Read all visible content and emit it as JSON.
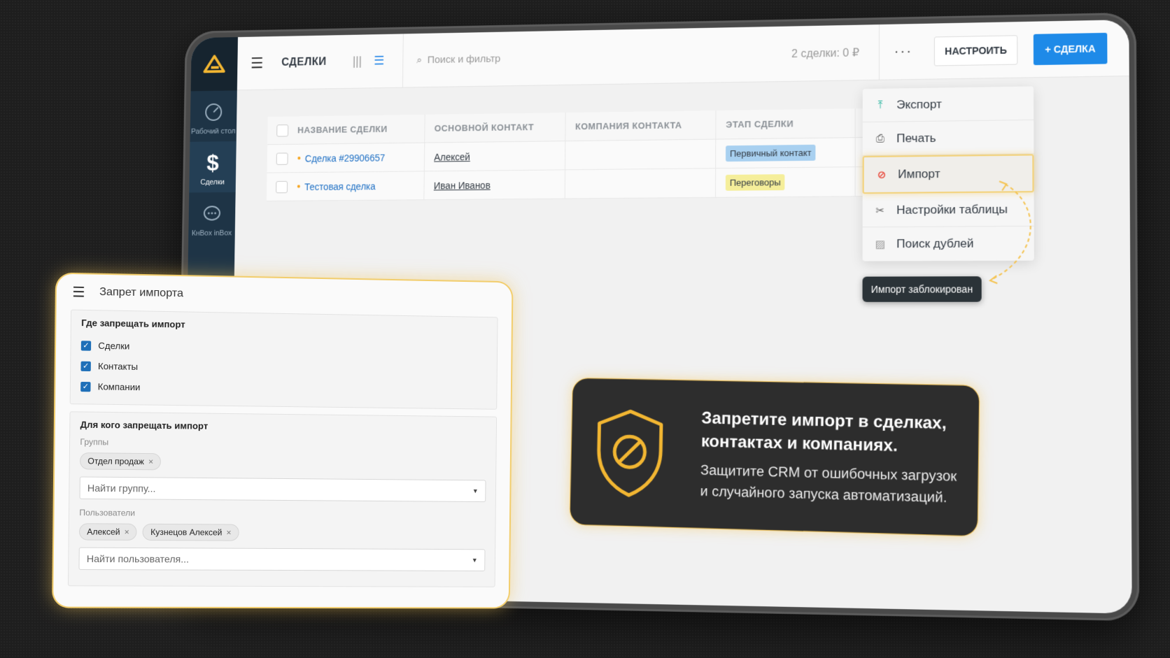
{
  "app": {
    "sidebar": {
      "items": [
        {
          "label": "Рабочий стол",
          "icon": "dashboard-icon"
        },
        {
          "label": "Сделки",
          "icon": "dollar-icon",
          "active": true
        },
        {
          "label": "КнBox inBox",
          "icon": "chat-icon"
        }
      ]
    },
    "topbar": {
      "title": "СДЕЛКИ",
      "search_placeholder": "Поиск и фильтр",
      "deal_count": "2 сделки: 0 ₽",
      "more": "···",
      "setup_button": "НАСТРОИТЬ",
      "add_button": "+ СДЕЛКА"
    },
    "table": {
      "columns": [
        "НАЗВАНИЕ СДЕЛКИ",
        "ОСНОВНОЙ КОНТАКТ",
        "КОМПАНИЯ КОНТАКТА",
        "ЭТАП СДЕЛКИ",
        ""
      ],
      "rows": [
        {
          "name": "Сделка #29906657",
          "contact": "Алексей",
          "company": "",
          "stage": "Первичный контакт",
          "stage_color": "#a8d0f0"
        },
        {
          "name": "Тестовая сделка",
          "contact": "Иван Иванов",
          "company": "",
          "stage": "Переговоры",
          "stage_color": "#f5ee9a"
        }
      ]
    },
    "menu": {
      "items": [
        {
          "label": "Экспорт",
          "icon": "upload-icon"
        },
        {
          "label": "Печать",
          "icon": "print-icon"
        },
        {
          "label": "Импорт",
          "icon": "blocked-icon",
          "highlighted": true
        },
        {
          "label": "Настройки таблицы",
          "icon": "tools-icon"
        },
        {
          "label": "Поиск дублей",
          "icon": "duplicates-icon"
        }
      ]
    },
    "tooltip": "Импорт заблокирован"
  },
  "callout": {
    "title_line1": "Запретите импорт в сделках,",
    "title_line2": "контактах и компаниях.",
    "text_line1": "Защитите CRM от ошибочных загрузок",
    "text_line2": "и случайного запуска автоматизаций."
  },
  "panel": {
    "title": "Запрет импорта",
    "where": {
      "heading": "Где запрещать импорт",
      "options": [
        "Сделки",
        "Контакты",
        "Компании"
      ]
    },
    "whom": {
      "heading": "Для кого запрещать импорт",
      "groups_label": "Группы",
      "groups": [
        "Отдел продаж"
      ],
      "groups_placeholder": "Найти группу...",
      "users_label": "Пользователи",
      "users": [
        "Алексей",
        "Кузнецов Алексей"
      ],
      "users_placeholder": "Найти пользователя..."
    }
  },
  "colors": {
    "accent": "#1e8ae8",
    "gold": "#f4c455",
    "sidebar": "#1e3446",
    "blocked": "#e8483b"
  }
}
